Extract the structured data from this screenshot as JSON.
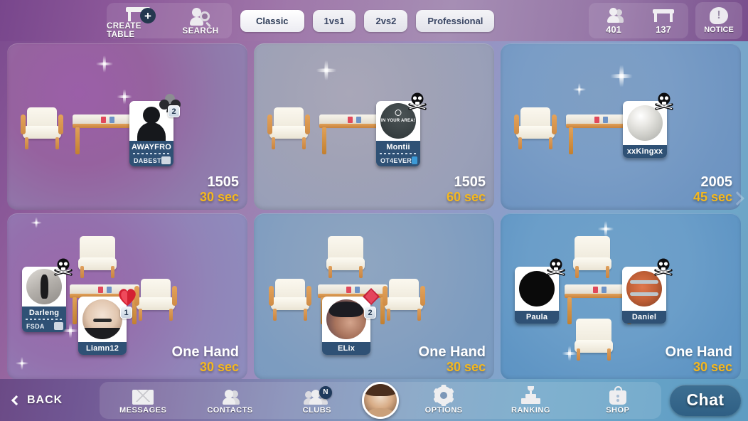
{
  "topbar": {
    "create_table": {
      "label": "CREATE TABLE",
      "icon": "table-plus-icon"
    },
    "search": {
      "label": "SEARCH",
      "icon": "search-icon"
    },
    "modes": [
      {
        "label": "Classic",
        "selected": true
      },
      {
        "label": "1vs1",
        "selected": false
      },
      {
        "label": "2vs2",
        "selected": false
      },
      {
        "label": "Professional",
        "selected": false
      }
    ],
    "counters": [
      {
        "icon": "people-icon",
        "value": "401",
        "name": "players-online-count"
      },
      {
        "icon": "table-icon",
        "value": "137",
        "name": "tables-open-count"
      }
    ],
    "notice": {
      "label": "NOTICE",
      "icon": "notice-bubble-icon"
    }
  },
  "tables": [
    {
      "id": "table-1",
      "theme": "v-purple",
      "bet": "1505",
      "time": "30 sec",
      "layout": "one-seat",
      "players": [
        {
          "name": "AWAYFRO",
          "club": "DABEST",
          "avatar": "silhouette",
          "badge": "club-suit",
          "badge_count": "2",
          "club_icon": "grey"
        }
      ]
    },
    {
      "id": "table-2",
      "theme": "v-grey",
      "bet": "1505",
      "time": "60 sec",
      "layout": "one-seat",
      "players": [
        {
          "name": "Montii",
          "club": "OT4EVER",
          "avatar": "montii",
          "avatar_text": "IN YOUR AREA!",
          "badge": "skull",
          "club_icon": "blue"
        }
      ]
    },
    {
      "id": "table-3",
      "theme": "v-blue",
      "bet": "2005",
      "time": "45 sec",
      "layout": "one-seat",
      "players": [
        {
          "name": "xxKingxx",
          "club": "",
          "avatar": "king",
          "badge": "skull"
        }
      ]
    },
    {
      "id": "table-4",
      "theme": "v-purple2",
      "bet": "One Hand",
      "time": "30 sec",
      "layout": "two-seat-left",
      "players": [
        {
          "name": "Darleng",
          "club": "FSDA",
          "avatar": "darleng",
          "badge": "skull",
          "club_icon": "grey"
        },
        {
          "name": "Liamn12",
          "club": "",
          "avatar": "liamn",
          "badge": "heart",
          "badge_count": "1"
        }
      ]
    },
    {
      "id": "table-5",
      "theme": "v-steel",
      "bet": "One Hand",
      "time": "30 sec",
      "layout": "three-seat",
      "players": [
        {
          "name": "ELix",
          "club": "",
          "avatar": "elix",
          "badge": "diamond",
          "badge_count": "2"
        }
      ]
    },
    {
      "id": "table-6",
      "theme": "v-blue2",
      "bet": "One Hand",
      "time": "30 sec",
      "layout": "four-seat",
      "players": [
        {
          "name": "Paula",
          "club": "",
          "avatar": "paula",
          "badge": "skull"
        },
        {
          "name": "Daniel",
          "club": "",
          "avatar": "daniel",
          "badge": "skull"
        }
      ]
    }
  ],
  "scroll": {
    "right_arrow": "chevron-right-icon"
  },
  "bottombar": {
    "back": {
      "label": "BACK",
      "icon": "chevron-left-icon"
    },
    "items": [
      {
        "label": "MESSAGES",
        "icon": "mail-icon",
        "badge": ""
      },
      {
        "label": "CONTACTS",
        "icon": "contacts-icon",
        "badge": ""
      },
      {
        "label": "CLUBS",
        "icon": "clubs-icon",
        "badge": "N"
      },
      {
        "label": "OPTIONS",
        "icon": "gear-icon",
        "badge": ""
      },
      {
        "label": "RANKING",
        "icon": "trophy-podium-icon",
        "badge": ""
      },
      {
        "label": "SHOP",
        "icon": "shopping-bag-icon",
        "badge": ""
      }
    ],
    "avatar": {
      "name": "user-avatar"
    },
    "chat": {
      "label": "Chat"
    }
  },
  "colors": {
    "accent_time": "#f5b81e",
    "plate_name_bg": "#2f5175",
    "badge_bg": "#1f3a5c"
  }
}
